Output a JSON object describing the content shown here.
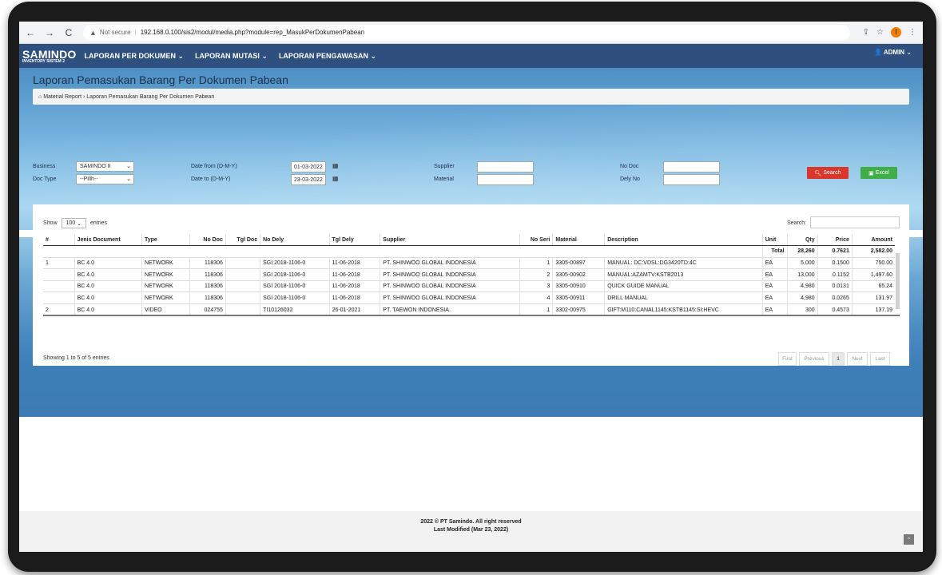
{
  "browser": {
    "security": "Not secure",
    "url": "192.168.0.100/sis2/modul/media.php?module=rep_MasukPerDokumenPabean",
    "profile_initial": "I"
  },
  "app": {
    "brand": "SAMINDO",
    "brand_sub": "INVENTORY SISTEM 2",
    "menu": [
      {
        "label": "LAPORAN PER DOKUMEN ⌄"
      },
      {
        "label": "LAPORAN MUTASI ⌄"
      },
      {
        "label": "LAPORAN PENGAWASAN ⌄"
      }
    ],
    "user": "ADMIN"
  },
  "page": {
    "title": "Laporan Pemasukan Barang Per Dokumen Pabean",
    "breadcrumb_root": "Material Report",
    "breadcrumb_current": "Laporan Pemasukan Barang Per Dokumen Pabean"
  },
  "filters": {
    "business_label": "Business",
    "business_value": "SAMINDO II",
    "doctype_label": "Doc Type",
    "doctype_value": "--Pilih--",
    "date_from_label": "Date from (D-M-Y)",
    "date_from_value": "01-03-2022",
    "date_to_label": "Date to (D-M-Y)",
    "date_to_value": "23-03-2022",
    "supplier_label": "Supplier",
    "material_label": "Material",
    "nodoc_label": "No Doc",
    "delyno_label": "Dely No",
    "search_btn": "Search",
    "excel_btn": "Excel"
  },
  "table_controls": {
    "show_prefix": "Show",
    "page_length": "100",
    "show_suffix": "entries",
    "search_label": "Search:"
  },
  "table": {
    "headers": [
      "#",
      "Jenis Document",
      "Type",
      "No Doc",
      "Tgl Doc",
      "No Dely",
      "Tgl Dely",
      "Supplier",
      "No Seri",
      "Material",
      "Description",
      "Unit",
      "Qty",
      "Price",
      "Amount"
    ],
    "total": {
      "label": "Total",
      "qty": "28,260",
      "price": "0.7621",
      "amount": "2,582.00"
    },
    "rows": [
      [
        "1",
        "BC 4.0",
        "NETWORK",
        "118306",
        "",
        "SGI 2018-1106-0",
        "11-06-2018",
        "PT. SHINWOO GLOBAL INDONESIA",
        "1",
        "3305-00897",
        "MANUAL: DC:VDSL:DG3420TD:4C",
        "EA",
        "5,000",
        "0.1500",
        "750.00"
      ],
      [
        "",
        "BC 4.0",
        "NETWORK",
        "118306",
        "",
        "SGI 2018-1106-0",
        "11-06-2018",
        "PT. SHINWOO GLOBAL INDONESIA",
        "2",
        "3305-00902",
        "MANUAL:AZAMTV:KSTB2013",
        "EA",
        "13,000",
        "0.1152",
        "1,497.60"
      ],
      [
        "",
        "BC 4.0",
        "NETWORK",
        "118306",
        "",
        "SGI 2018-1106-0",
        "11-06-2018",
        "PT. SHINWOO GLOBAL INDONESIA",
        "3",
        "3305-00910",
        "QUICK GUIDE MANUAL",
        "EA",
        "4,980",
        "0.0131",
        "65.24"
      ],
      [
        "",
        "BC 4.0",
        "NETWORK",
        "118306",
        "",
        "SGI 2018-1106-0",
        "11-06-2018",
        "PT. SHINWOO GLOBAL INDONESIA",
        "4",
        "3305-00911",
        "DRILL MANUAL",
        "EA",
        "4,980",
        "0.0265",
        "131.97"
      ],
      [
        "2",
        "BC 4.0",
        "VIDEO",
        "024755",
        "",
        "TI10126032",
        "26-01-2021",
        "PT. TAEWON INDONESIA",
        "1",
        "3302-00975",
        "GIFT:M110:CANAL1145:KSTB1145:SI:HEVC",
        "EA",
        "300",
        "0.4573",
        "137.19"
      ]
    ]
  },
  "pagination": {
    "info": "Showing 1 to 5 of 5 entries",
    "first": "First",
    "previous": "Previous",
    "current": "1",
    "next": "Next",
    "last": "Last"
  },
  "footer": {
    "line1": "2022 © PT Samindo. All right reserved",
    "line2": "Last Modified (Mar 23, 2022)"
  }
}
